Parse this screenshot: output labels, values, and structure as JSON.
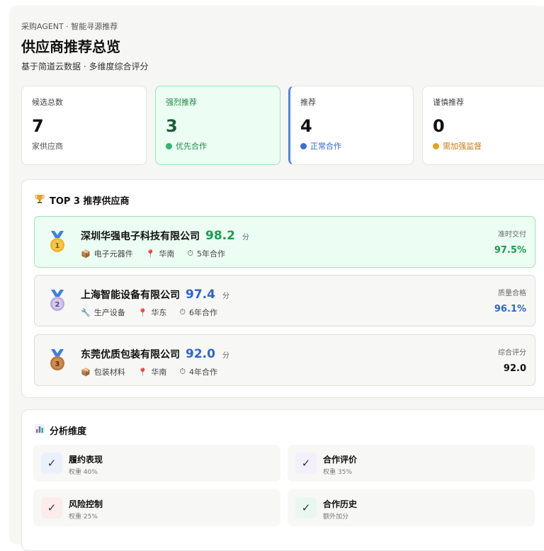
{
  "header": {
    "breadcrumb": "采购AGENT · 智能寻源推荐",
    "title": "供应商推荐总览",
    "subtitle": "基于简道云数据 · 多维度综合评分"
  },
  "stats": [
    {
      "label": "候选总数",
      "value": "7",
      "sub": "家供应商"
    },
    {
      "label": "强烈推荐",
      "value": "3",
      "sub": "优先合作",
      "dot_color": "#2fb86a"
    },
    {
      "label": "推荐",
      "value": "4",
      "sub": "正常合作",
      "dot_color": "#3a6fd4"
    },
    {
      "label": "谨慎推荐",
      "value": "0",
      "sub": "需加强监督",
      "dot_color": "#e6a21d"
    }
  ],
  "top3": {
    "title": "TOP 3 推荐供应商",
    "icon": "trophy-icon",
    "suppliers": [
      {
        "rank": "1",
        "name": "深圳华强电子科技有限公司",
        "score": "98.2",
        "unit": "分",
        "category": "电子元器件",
        "category_icon": "box-icon",
        "region": "华南",
        "years": "5年合作",
        "metric_label": "准时交付",
        "metric_value": "97.5%",
        "score_color": "#1e9a4f",
        "metric_color": "#1e9a4f"
      },
      {
        "rank": "2",
        "name": "上海智能设备有限公司",
        "score": "97.4",
        "unit": "分",
        "category": "生产设备",
        "category_icon": "wrench-icon",
        "region": "华东",
        "years": "6年合作",
        "metric_label": "质量合格",
        "metric_value": "96.1%",
        "score_color": "#2e66c7",
        "metric_color": "#2e66c7"
      },
      {
        "rank": "3",
        "name": "东莞优质包装有限公司",
        "score": "92.0",
        "unit": "分",
        "category": "包装材料",
        "category_icon": "box-icon",
        "region": "华南",
        "years": "4年合作",
        "metric_label": "综合评分",
        "metric_value": "92.0",
        "score_color": "#2e66c7",
        "metric_color": "#111111"
      }
    ]
  },
  "dimensions": {
    "title": "分析维度",
    "icon": "bar-chart-icon",
    "items": [
      {
        "name": "履约表现",
        "weight": "权重 40%",
        "icon_bg": "#eaf1fd"
      },
      {
        "name": "合作评价",
        "weight": "权重 35%",
        "icon_bg": "#f3effb"
      },
      {
        "name": "风险控制",
        "weight": "权重 25%",
        "icon_bg": "#fdecec"
      },
      {
        "name": "合作历史",
        "weight": "额外加分",
        "icon_bg": "#e9f8ef"
      }
    ]
  }
}
